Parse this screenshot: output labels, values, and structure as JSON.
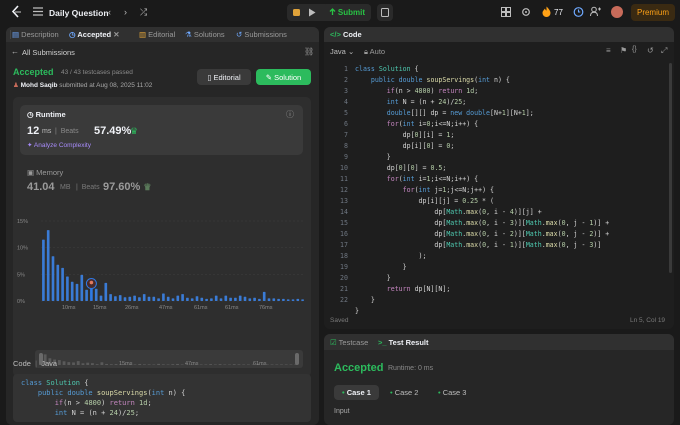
{
  "topbar": {
    "title": "Daily Question",
    "submit_label": "Submit",
    "streak": "77",
    "premium_label": "Premium"
  },
  "left_tabs": [
    "Description",
    "Accepted",
    "Editorial",
    "Solutions",
    "Submissions"
  ],
  "submission": {
    "back_label": "All Submissions",
    "status": "Accepted",
    "passed": "43 / 43 testcases passed",
    "author": "Mohd Saqib",
    "submitted_at": "submitted at Aug 08, 2025 11:02",
    "editorial_label": "Editorial",
    "solution_label": "Solution"
  },
  "runtime": {
    "label": "Runtime",
    "value": "12",
    "unit": "ms",
    "beats_label": "Beats",
    "beats_pct": "57.49%",
    "analyze_label": "Analyze Complexity"
  },
  "memory": {
    "label": "Memory",
    "value": "41.04",
    "unit": "MB",
    "beats_label": "Beats",
    "beats_pct": "97.60%"
  },
  "chart_data": {
    "type": "bar",
    "y_ticks": [
      "15%",
      "10%",
      "5%",
      "0%"
    ],
    "ylim": [
      0,
      15
    ],
    "x_tick_labels": [
      "10ms",
      "15ms",
      "26ms",
      "47ms",
      "61ms",
      "61ms",
      "76ms"
    ],
    "values": [
      11.5,
      13.3,
      8.4,
      6.8,
      6.2,
      4.6,
      3.6,
      3.2,
      4.9,
      2.1,
      2.9,
      2.3,
      1.0,
      3.4,
      1.3,
      0.9,
      1.1,
      0.7,
      0.8,
      1.0,
      0.7,
      1.3,
      0.8,
      0.8,
      0.5,
      1.4,
      0.8,
      0.5,
      1.0,
      1.3,
      0.6,
      0.5,
      0.9,
      0.6,
      0.4,
      0.5,
      1.0,
      0.5,
      1.0,
      0.6,
      0.6,
      1.0,
      0.8,
      0.5,
      0.6,
      0.4,
      1.7,
      0.5,
      0.5,
      0.4,
      0.4,
      0.3,
      0.3,
      0.4,
      0.3
    ],
    "highlight_index": 10,
    "range_labels": [
      "15ms",
      "47ms",
      "61ms"
    ]
  },
  "code_section": {
    "label": "Code",
    "language": "Java",
    "lines": [
      "class Solution {",
      "    public double soupServings(int n) {",
      "        if(n > 4800) return 1d;",
      "        int N = (n + 24)/25;"
    ]
  },
  "editor": {
    "title": "Code",
    "language": "Java",
    "auto_label": "Auto",
    "line_numbers": [
      "1",
      "2",
      "3",
      "4",
      "5",
      "6",
      "7",
      "8",
      "9",
      "10",
      "11",
      "12",
      "13",
      "14",
      "15",
      "16",
      "17",
      "18",
      "19",
      "20",
      "21",
      "22"
    ],
    "saved_label": "Saved",
    "cursor": "Ln 5, Col 19"
  },
  "result": {
    "tabs": [
      "Testcase",
      "Test Result"
    ],
    "status": "Accepted",
    "runtime": "Runtime: 0 ms",
    "cases": [
      "Case 1",
      "Case 2",
      "Case 3"
    ],
    "input_label": "Input"
  }
}
